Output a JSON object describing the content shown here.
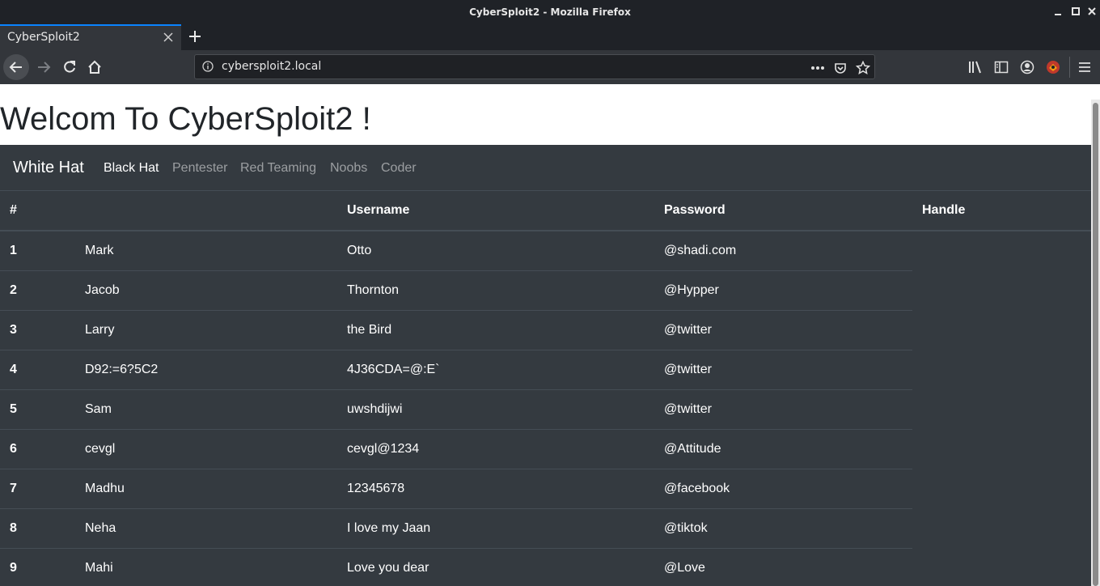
{
  "window": {
    "title": "CyberSploit2 - Mozilla Firefox"
  },
  "browser": {
    "tab_label": "CyberSploit2",
    "url": "cybersploit2.local"
  },
  "page": {
    "heading": "Welcom To CyberSploit2 !",
    "brand": "White Hat",
    "nav": [
      "Black Hat",
      "Pentester",
      "Red Teaming",
      "Noobs",
      "Coder"
    ],
    "table": {
      "headers": [
        "#",
        "",
        "Username",
        "Password",
        "Handle"
      ],
      "rows": [
        [
          "1",
          "Mark",
          "Otto",
          "@shadi.com"
        ],
        [
          "2",
          "Jacob",
          "Thornton",
          "@Hypper"
        ],
        [
          "3",
          "Larry",
          "the Bird",
          "@twitter"
        ],
        [
          "4",
          "D92:=6?5C2",
          "4J36CDA=@:E`",
          "@twitter"
        ],
        [
          "5",
          "Sam",
          "uwshdijwi",
          "@twitter"
        ],
        [
          "6",
          "cevgl",
          "cevgl@1234",
          "@Attitude"
        ],
        [
          "7",
          "Madhu",
          "12345678",
          "@facebook"
        ],
        [
          "8",
          "Neha",
          "I love my Jaan",
          "@tiktok"
        ],
        [
          "9",
          "Mahi",
          "Love you dear",
          "@Love"
        ]
      ]
    }
  },
  "colors": {
    "accent": "#0a84ff",
    "page_bg": "#343a40",
    "text": "#ffffff"
  }
}
